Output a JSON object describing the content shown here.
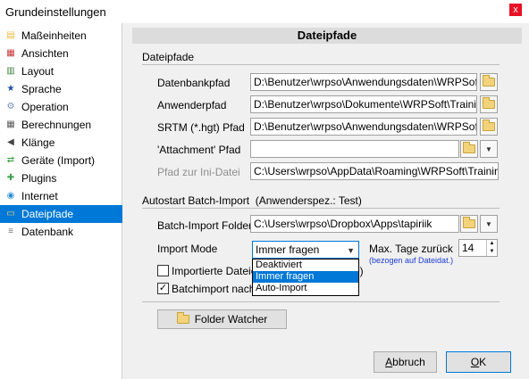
{
  "window": {
    "title": "Grundeinstellungen",
    "close": "x"
  },
  "sidebar": {
    "items": [
      {
        "label": "Maßeinheiten",
        "icon": "ruler-icon",
        "color": "#f1b83a",
        "glyph": "▤"
      },
      {
        "label": "Ansichten",
        "icon": "calendar-icon",
        "color": "#c83232",
        "glyph": "▦"
      },
      {
        "label": "Layout",
        "icon": "layout-icon",
        "color": "#3a7f3a",
        "glyph": "▥"
      },
      {
        "label": "Sprache",
        "icon": "flag-icon",
        "color": "#1f4fa8",
        "glyph": "★"
      },
      {
        "label": "Operation",
        "icon": "wrench-icon",
        "color": "#6f8fb5",
        "glyph": "⚙"
      },
      {
        "label": "Berechnungen",
        "icon": "calculator-icon",
        "color": "#5a5a5a",
        "glyph": "▦"
      },
      {
        "label": "Klänge",
        "icon": "speaker-icon",
        "color": "#444444",
        "glyph": "◀"
      },
      {
        "label": "Geräte (Import)",
        "icon": "device-icon",
        "color": "#2e9b3c",
        "glyph": "⇄"
      },
      {
        "label": "Plugins",
        "icon": "plugin-icon",
        "color": "#3aa14a",
        "glyph": "✚"
      },
      {
        "label": "Internet",
        "icon": "globe-icon",
        "color": "#2f8fd3",
        "glyph": "◉"
      },
      {
        "label": "Dateipfade",
        "icon": "folder-icon",
        "color": "#f3d37a",
        "glyph": "▭"
      },
      {
        "label": "Datenbank",
        "icon": "database-icon",
        "color": "#777777",
        "glyph": "≡"
      }
    ],
    "selected": "Dateipfade"
  },
  "header": {
    "title": "Dateipfade"
  },
  "paths": {
    "section_title": "Dateipfade",
    "datenbank": {
      "label": "Datenbankpfad",
      "value": "D:\\Benutzer\\wrpso\\Anwendungsdaten\\WRPSoft\\Tra"
    },
    "anwender": {
      "label": "Anwenderpfad",
      "value": "D:\\Benutzer\\wrpso\\Dokumente\\WRPSoft\\TrainingLa"
    },
    "srtm": {
      "label": "SRTM (*.hgt) Pfad",
      "value": "D:\\Benutzer\\wrpso\\Anwendungsdaten\\WRPSoft\\Tra"
    },
    "attachment": {
      "label": "'Attachment' Pfad",
      "value": ""
    },
    "ini": {
      "label": "Pfad zur Ini-Datei",
      "value": "C:\\Users\\wrpso\\AppData\\Roaming\\WRPSoft\\TrainingLab"
    }
  },
  "batch": {
    "section_title": "Autostart Batch-Import",
    "section_note": "(Anwenderspez.: Test)",
    "folder_label": "Batch-Import Folder",
    "folder_value": "C:\\Users\\wrpso\\Dropbox\\Apps\\tapiriik",
    "mode_label": "Import Mode",
    "mode_selected": "Immer fragen",
    "mode_options": [
      "Deaktiviert",
      "Immer fragen",
      "Auto-Import"
    ],
    "max_days_label": "Max. Tage zurück",
    "max_days_value": "14",
    "max_days_hint": "(bezogen auf Dateidat.)",
    "check1_label": "Importierte Dateie",
    "check1_tail": "e)",
    "check1_checked": false,
    "check2_label": "Batchimport nach U",
    "check2_checked": true,
    "folder_watcher_label": "Folder Watcher"
  },
  "footer": {
    "cancel_prefix": "A",
    "cancel_rest": "bbruch",
    "ok_prefix": "O",
    "ok_rest": "K"
  }
}
